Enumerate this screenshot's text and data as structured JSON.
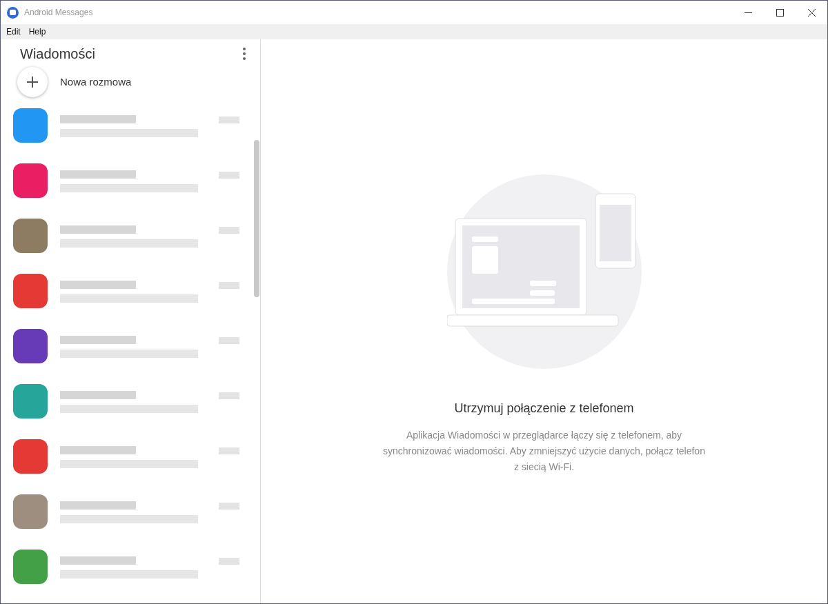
{
  "window": {
    "title": "Android Messages"
  },
  "menu": [
    "Edit",
    "Help"
  ],
  "sidebar": {
    "title": "Wiadomości",
    "new_conversation": "Nowa rozmowa",
    "conversations": [
      {
        "color": "#2196f3"
      },
      {
        "color": "#e91e63"
      },
      {
        "color": "#8d7b62"
      },
      {
        "color": "#e53935"
      },
      {
        "color": "#673ab7"
      },
      {
        "color": "#26a69a"
      },
      {
        "color": "#e53935"
      },
      {
        "color": "#9e8e80"
      },
      {
        "color": "#43a047"
      }
    ]
  },
  "empty_state": {
    "heading": "Utrzymuj połączenie z telefonem",
    "body": "Aplikacja Wiadomości w przeglądarce łączy się z telefonem, aby synchronizować wiadomości. Aby zmniejszyć użycie danych, połącz telefon z siecią Wi-Fi."
  }
}
